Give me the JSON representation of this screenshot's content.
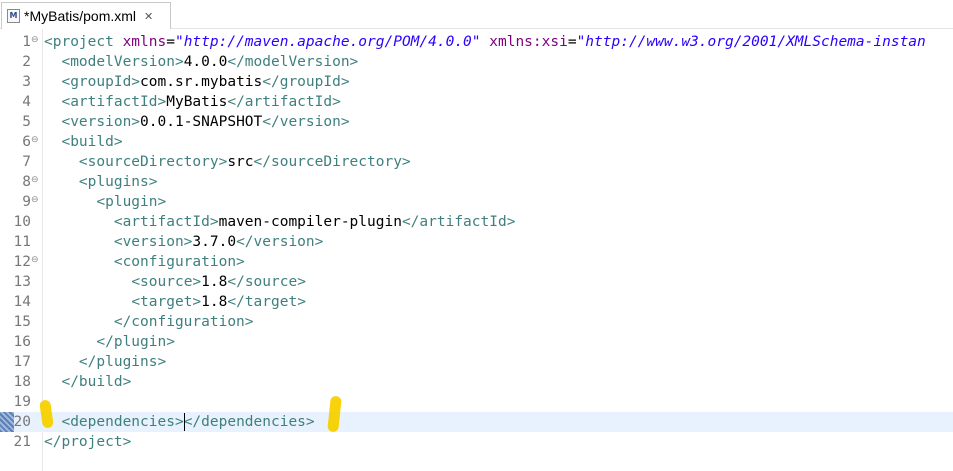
{
  "tab": {
    "title": "*MyBatis/pom.xml",
    "icon_label": "M",
    "icon": "maven-pom-file-icon",
    "close_glyph": "✕"
  },
  "colors": {
    "tag": "#3f7f7f",
    "attr": "#7f007f",
    "value": "#2a00ff",
    "current_line": "#e8f2fe",
    "highlight": "#f7d000"
  },
  "editor": {
    "current_line": 20,
    "lines": [
      {
        "n": "1",
        "fold": true,
        "segs": [
          [
            "tag",
            "<project "
          ],
          [
            "attr",
            "xmlns"
          ],
          [
            "txt",
            "="
          ],
          [
            "val",
            "\"http://maven.apache.org/POM/4.0.0\""
          ],
          [
            "txt",
            " "
          ],
          [
            "attr",
            "xmlns:xsi"
          ],
          [
            "txt",
            "="
          ],
          [
            "val",
            "\"http://www.w3.org/2001/XMLSchema-instan"
          ]
        ]
      },
      {
        "n": "2",
        "fold": false,
        "segs": [
          [
            "txt",
            "  "
          ],
          [
            "tag",
            "<modelVersion>"
          ],
          [
            "txt",
            "4.0.0"
          ],
          [
            "tag",
            "</modelVersion>"
          ]
        ]
      },
      {
        "n": "3",
        "fold": false,
        "segs": [
          [
            "txt",
            "  "
          ],
          [
            "tag",
            "<groupId>"
          ],
          [
            "txt",
            "com.sr.mybatis"
          ],
          [
            "tag",
            "</groupId>"
          ]
        ]
      },
      {
        "n": "4",
        "fold": false,
        "segs": [
          [
            "txt",
            "  "
          ],
          [
            "tag",
            "<artifactId>"
          ],
          [
            "txt",
            "MyBatis"
          ],
          [
            "tag",
            "</artifactId>"
          ]
        ]
      },
      {
        "n": "5",
        "fold": false,
        "segs": [
          [
            "txt",
            "  "
          ],
          [
            "tag",
            "<version>"
          ],
          [
            "txt",
            "0.0.1-SNAPSHOT"
          ],
          [
            "tag",
            "</version>"
          ]
        ]
      },
      {
        "n": "6",
        "fold": true,
        "segs": [
          [
            "txt",
            "  "
          ],
          [
            "tag",
            "<build>"
          ]
        ]
      },
      {
        "n": "7",
        "fold": false,
        "segs": [
          [
            "txt",
            "    "
          ],
          [
            "tag",
            "<sourceDirectory>"
          ],
          [
            "txt",
            "src"
          ],
          [
            "tag",
            "</sourceDirectory>"
          ]
        ]
      },
      {
        "n": "8",
        "fold": true,
        "segs": [
          [
            "txt",
            "    "
          ],
          [
            "tag",
            "<plugins>"
          ]
        ]
      },
      {
        "n": "9",
        "fold": true,
        "segs": [
          [
            "txt",
            "      "
          ],
          [
            "tag",
            "<plugin>"
          ]
        ]
      },
      {
        "n": "10",
        "fold": false,
        "segs": [
          [
            "txt",
            "        "
          ],
          [
            "tag",
            "<artifactId>"
          ],
          [
            "txt",
            "maven-compiler-plugin"
          ],
          [
            "tag",
            "</artifactId>"
          ]
        ]
      },
      {
        "n": "11",
        "fold": false,
        "segs": [
          [
            "txt",
            "        "
          ],
          [
            "tag",
            "<version>"
          ],
          [
            "txt",
            "3.7.0"
          ],
          [
            "tag",
            "</version>"
          ]
        ]
      },
      {
        "n": "12",
        "fold": true,
        "segs": [
          [
            "txt",
            "        "
          ],
          [
            "tag",
            "<configuration>"
          ]
        ]
      },
      {
        "n": "13",
        "fold": false,
        "segs": [
          [
            "txt",
            "          "
          ],
          [
            "tag",
            "<source>"
          ],
          [
            "txt",
            "1.8"
          ],
          [
            "tag",
            "</source>"
          ]
        ]
      },
      {
        "n": "14",
        "fold": false,
        "segs": [
          [
            "txt",
            "          "
          ],
          [
            "tag",
            "<target>"
          ],
          [
            "txt",
            "1.8"
          ],
          [
            "tag",
            "</target>"
          ]
        ]
      },
      {
        "n": "15",
        "fold": false,
        "segs": [
          [
            "txt",
            "        "
          ],
          [
            "tag",
            "</configuration>"
          ]
        ]
      },
      {
        "n": "16",
        "fold": false,
        "segs": [
          [
            "txt",
            "      "
          ],
          [
            "tag",
            "</plugin>"
          ]
        ]
      },
      {
        "n": "17",
        "fold": false,
        "segs": [
          [
            "txt",
            "    "
          ],
          [
            "tag",
            "</plugins>"
          ]
        ]
      },
      {
        "n": "18",
        "fold": false,
        "segs": [
          [
            "txt",
            "  "
          ],
          [
            "tag",
            "</build>"
          ]
        ]
      },
      {
        "n": "19",
        "fold": false,
        "segs": []
      },
      {
        "n": "20",
        "fold": false,
        "segs": [
          [
            "txt",
            "  "
          ],
          [
            "tag",
            "<dependencies>"
          ],
          [
            "tag",
            "</dependencies>"
          ]
        ]
      },
      {
        "n": "21",
        "fold": false,
        "segs": [
          [
            "tag",
            "</project>"
          ]
        ]
      }
    ]
  }
}
